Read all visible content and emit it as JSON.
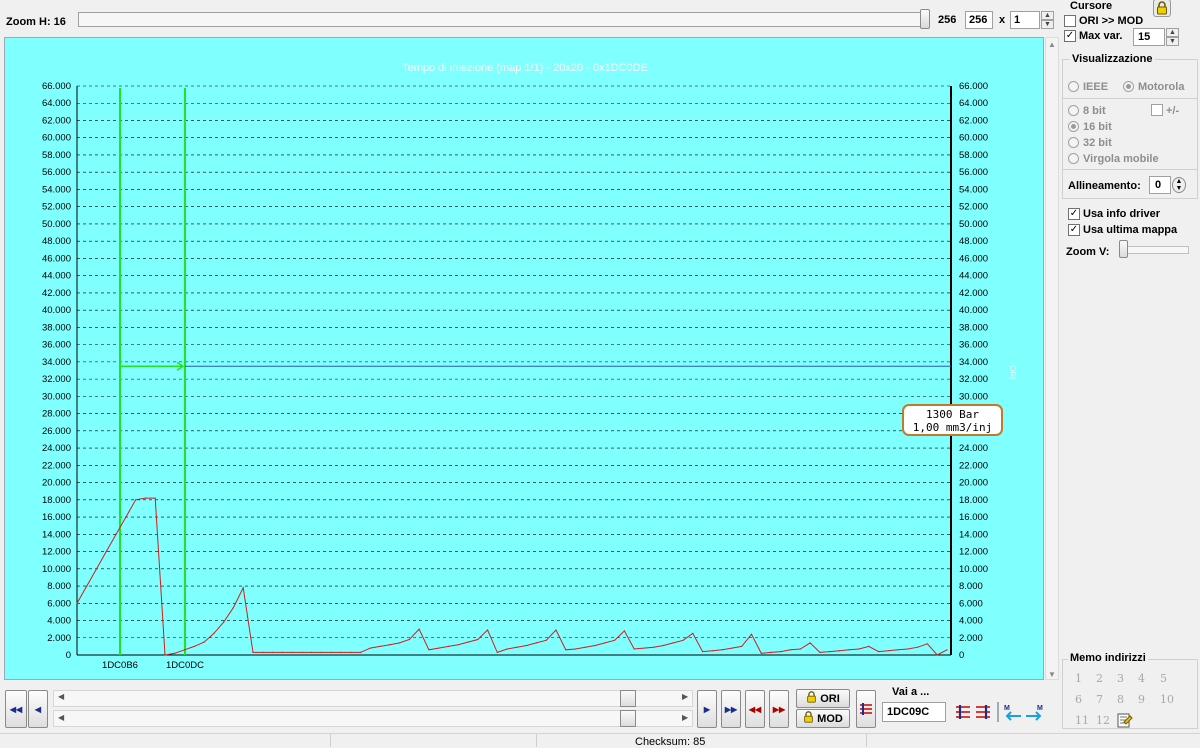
{
  "toolbar": {
    "zoom_h_label": "Zoom H: 16",
    "zoom_value": "256",
    "width_value": "256",
    "times": "x",
    "height_value": "1"
  },
  "cursor": {
    "title": "Cursore",
    "ori_mod_label": "ORI >> MOD",
    "ori_mod_checked": false,
    "max_var_label": "Max var.",
    "max_var_checked": true,
    "max_var_value": "15"
  },
  "visualization": {
    "title": "Visualizzazione",
    "ieee": "IEEE",
    "motorola": "Motorola",
    "bit8": "8 bit",
    "plusminus": "+/-",
    "bit16": "16 bit",
    "bit32": "32 bit",
    "float": "Virgola mobile",
    "alignment_label": "Allineamento:",
    "alignment_value": "0",
    "use_driver_info": "Usa info driver",
    "use_last_map": "Usa ultima mappa",
    "zoom_v_label": "Zoom V:"
  },
  "memo": {
    "title": "Memo indirizzi",
    "slots": [
      "1",
      "2",
      "3",
      "4",
      "5",
      "6",
      "7",
      "8",
      "9",
      "10",
      "11",
      "12"
    ]
  },
  "bottom": {
    "ori_label": "ORI",
    "mod_label": "MOD",
    "goto_label": "Vai a ...",
    "goto_value": "1DC09C"
  },
  "status": {
    "checksum": "Checksum: 85"
  },
  "chart_data": {
    "type": "line",
    "title": "Tempo di iniezione (map 1/1) - 20x20 - 0x1DC0DE",
    "ylim": [
      0,
      66000
    ],
    "y_ticks": [
      "0",
      "2.000",
      "4.000",
      "6.000",
      "8.000",
      "10.000",
      "12.000",
      "14.000",
      "16.000",
      "18.000",
      "20.000",
      "22.000",
      "24.000",
      "26.000",
      "28.000",
      "30.000",
      "32.000",
      "34.000",
      "36.000",
      "38.000",
      "40.000",
      "42.000",
      "44.000",
      "46.000",
      "48.000",
      "50.000",
      "52.000",
      "54.000",
      "56.000",
      "58.000",
      "60.000",
      "62.000",
      "64.000",
      "66.000"
    ],
    "right_axis_label": "ORI",
    "grid": true,
    "x_labels": [
      "1DC0B6",
      "1DC0DC"
    ],
    "cursor_tooltip": [
      "1300 Bar",
      "1,00 mm3/inj"
    ],
    "cursor_level": 33500,
    "colors": {
      "background": "#80ffff",
      "series": "#cc1f1f",
      "cursor": "#1fe41f",
      "level_line": "#2a5fb0",
      "title": "#ffffff"
    },
    "series": [
      {
        "values": [
          6000,
          8000,
          10000,
          12000,
          14000,
          16000,
          18000,
          18200,
          18200,
          0,
          200,
          600,
          1000,
          1500,
          2500,
          3800,
          5500,
          7800,
          300,
          300,
          300,
          300,
          300,
          300,
          300,
          300,
          300,
          300,
          300,
          300,
          800,
          1000,
          1200,
          1400,
          1800,
          3000,
          600,
          800,
          1000,
          1200,
          1500,
          1800,
          2900,
          300,
          700,
          900,
          1100,
          1400,
          1700,
          2900,
          600,
          700,
          900,
          1100,
          1400,
          1700,
          2800,
          700,
          800,
          900,
          1100,
          1400,
          1700,
          2500,
          400,
          500,
          600,
          800,
          1000,
          2400,
          200,
          300,
          400,
          600,
          700,
          1400,
          300,
          400,
          500,
          600,
          700,
          1000,
          400,
          500,
          600,
          700,
          900,
          1300,
          0,
          600
        ]
      }
    ]
  }
}
